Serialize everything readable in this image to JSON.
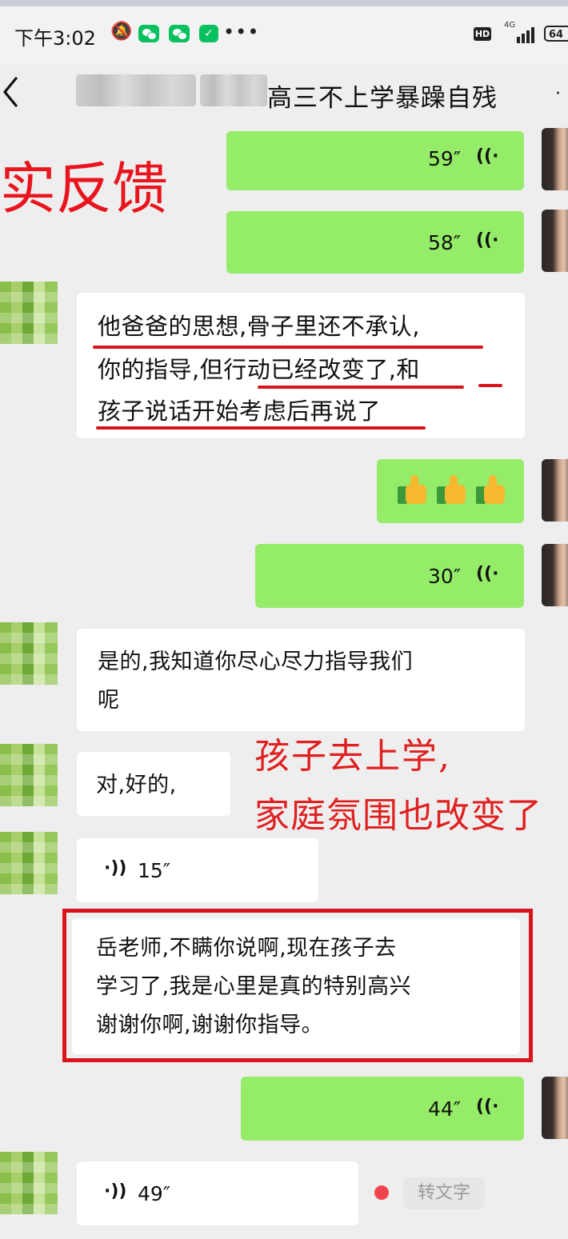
{
  "status_bar": {
    "time": "下午3:02",
    "hd_label": "HD",
    "network_label": "4G",
    "battery": "64"
  },
  "header": {
    "title": "高三不上学暴躁自残",
    "blurred_name": ""
  },
  "overlay": {
    "feedback_label": "实反馈",
    "annotation_line1": "孩子去上学,",
    "annotation_line2": "家庭氛围也改变了"
  },
  "messages": [
    {
      "side": "self",
      "type": "voice",
      "duration": "59″"
    },
    {
      "side": "self",
      "type": "voice",
      "duration": "58″"
    },
    {
      "side": "other",
      "type": "text",
      "lines": [
        "他爸爸的思想,骨子里还不承认,",
        "你的指导,但行动已经改变了,和",
        "孩子说话开始考虑后再说了"
      ]
    },
    {
      "side": "self",
      "type": "emoji",
      "count": 3
    },
    {
      "side": "self",
      "type": "voice",
      "duration": "30″"
    },
    {
      "side": "other",
      "type": "text",
      "lines": [
        "是的,我知道你尽心尽力指导我们",
        "呢"
      ]
    },
    {
      "side": "other",
      "type": "text",
      "lines": [
        "对,好的,"
      ]
    },
    {
      "side": "other",
      "type": "voice",
      "duration": "15″"
    },
    {
      "side": "other",
      "type": "text",
      "lines": [
        "岳老师,不瞒你说啊,现在孩子去",
        "学习了,我是心里是真的特别高兴",
        "谢谢你啊,谢谢你指导。"
      ]
    },
    {
      "side": "self",
      "type": "voice",
      "duration": "44″"
    },
    {
      "side": "other",
      "type": "voice",
      "duration": "49″",
      "transcribe_label": "转文字"
    }
  ],
  "colors": {
    "self_bubble": "#95ec69",
    "other_bubble": "#ffffff",
    "background": "#eeeeee",
    "annotation_red": "#d8141c",
    "wechat_green": "#07c160"
  },
  "icons": [
    "mute-icon",
    "wechat-icon",
    "shield-icon",
    "hd-icon",
    "signal-icon",
    "battery-icon",
    "back-icon",
    "voice-wave-icon",
    "thumbs-up-icon",
    "unread-dot-icon"
  ]
}
